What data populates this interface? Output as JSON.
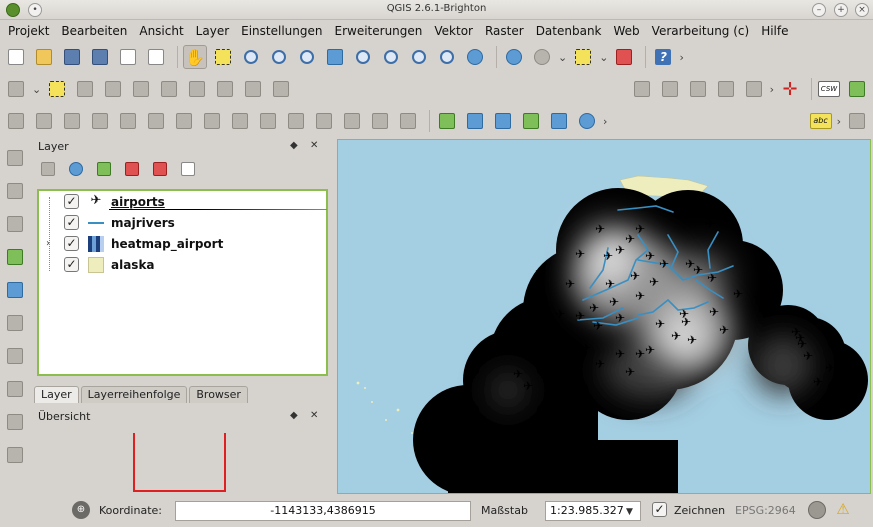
{
  "window": {
    "title": "QGIS 2.6.1-Brighton"
  },
  "menu": [
    "Projekt",
    "Bearbeiten",
    "Ansicht",
    "Layer",
    "Einstellungen",
    "Erweiterungen",
    "Vektor",
    "Raster",
    "Datenbank",
    "Web",
    "Verarbeitung (c)",
    "Hilfe"
  ],
  "toolbar": {
    "csw_label": "CSW",
    "abc_label": "abc",
    "help_label": "?"
  },
  "layer_panel": {
    "title": "Layer",
    "layers": [
      {
        "name": "airports",
        "checked": true,
        "symbol": "airplane-icon"
      },
      {
        "name": "majrivers",
        "checked": true,
        "symbol": "line-symbol"
      },
      {
        "name": "heatmap_airport",
        "checked": true,
        "symbol": "raster-symbol"
      },
      {
        "name": "alaska",
        "checked": true,
        "symbol": "polygon-symbol"
      }
    ]
  },
  "tabs": [
    "Layer",
    "Layerreihenfolge",
    "Browser"
  ],
  "overview": {
    "title": "Übersicht"
  },
  "statusbar": {
    "coord_label": "Koordinate:",
    "coord_value": "-1143133,4386915",
    "scale_label": "Maßstab",
    "scale_value": "1:23.985.327",
    "render_label": "Zeichnen",
    "render_checked": true,
    "crs": "EPSG:2964"
  },
  "colors": {
    "sea": "#a4cee2",
    "land": "#eeedbe",
    "river": "#3a8fc2",
    "accent": "#8cbd4f"
  }
}
